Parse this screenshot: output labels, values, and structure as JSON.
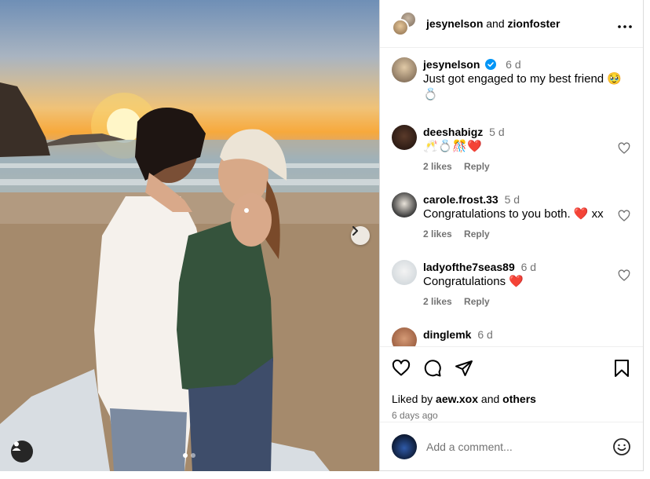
{
  "post": {
    "author_1": "jesynelson",
    "joiner": "and",
    "author_2": "zionfoster",
    "more_icon": "more-horizontal-icon"
  },
  "caption": {
    "username": "jesynelson",
    "time": "6 d",
    "text": "Just got engaged to my best friend 🥹 💍"
  },
  "comments": [
    {
      "username": "deeshabigz",
      "time": "5 d",
      "text": "🥂💍🎊❤️",
      "likes": "2 likes",
      "reply": "Reply"
    },
    {
      "username": "carole.frost.33",
      "time": "5 d",
      "text": "Congratulations to you both. ❤️ xx",
      "likes": "2 likes",
      "reply": "Reply"
    },
    {
      "username": "ladyofthe7seas89",
      "time": "6 d",
      "text": "Congratulations ❤️",
      "likes": "2 likes",
      "reply": "Reply"
    },
    {
      "username": "dinglemk",
      "time": "6 d"
    }
  ],
  "likes": {
    "prefix": "Liked by",
    "user": "aew.xox",
    "joiner": "and",
    "others": "others"
  },
  "date": "6 days ago",
  "add_comment": {
    "placeholder": "Add a comment..."
  },
  "icons": [
    "like-icon",
    "comment-icon",
    "share-icon",
    "save-icon",
    "emoji-icon",
    "next-arrow-icon",
    "user-tag-icon"
  ],
  "colors": {
    "verified": "#0095f6",
    "muted": "#737373",
    "border": "#dbdbdb"
  }
}
